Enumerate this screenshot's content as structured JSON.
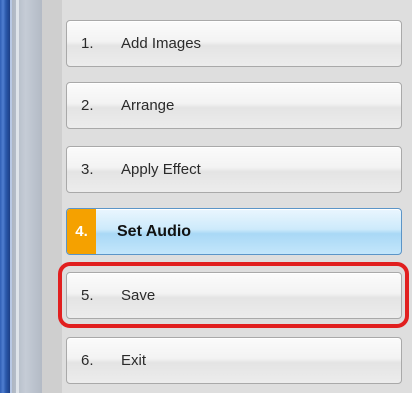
{
  "menu": {
    "items": [
      {
        "number": "1.",
        "label": "Add Images"
      },
      {
        "number": "2.",
        "label": "Arrange"
      },
      {
        "number": "3.",
        "label": "Apply Effect"
      },
      {
        "number": "4.",
        "label": "Set Audio"
      },
      {
        "number": "5.",
        "label": "Save"
      },
      {
        "number": "6.",
        "label": "Exit"
      }
    ],
    "active_item_label": "Set Audio",
    "highlighted_item_label": "Save"
  },
  "colors": {
    "active_badge": "#f5a100",
    "active_button": "#cdeafb",
    "highlight_outline": "#e11f1f",
    "window_edge": "#2f5fb5"
  }
}
